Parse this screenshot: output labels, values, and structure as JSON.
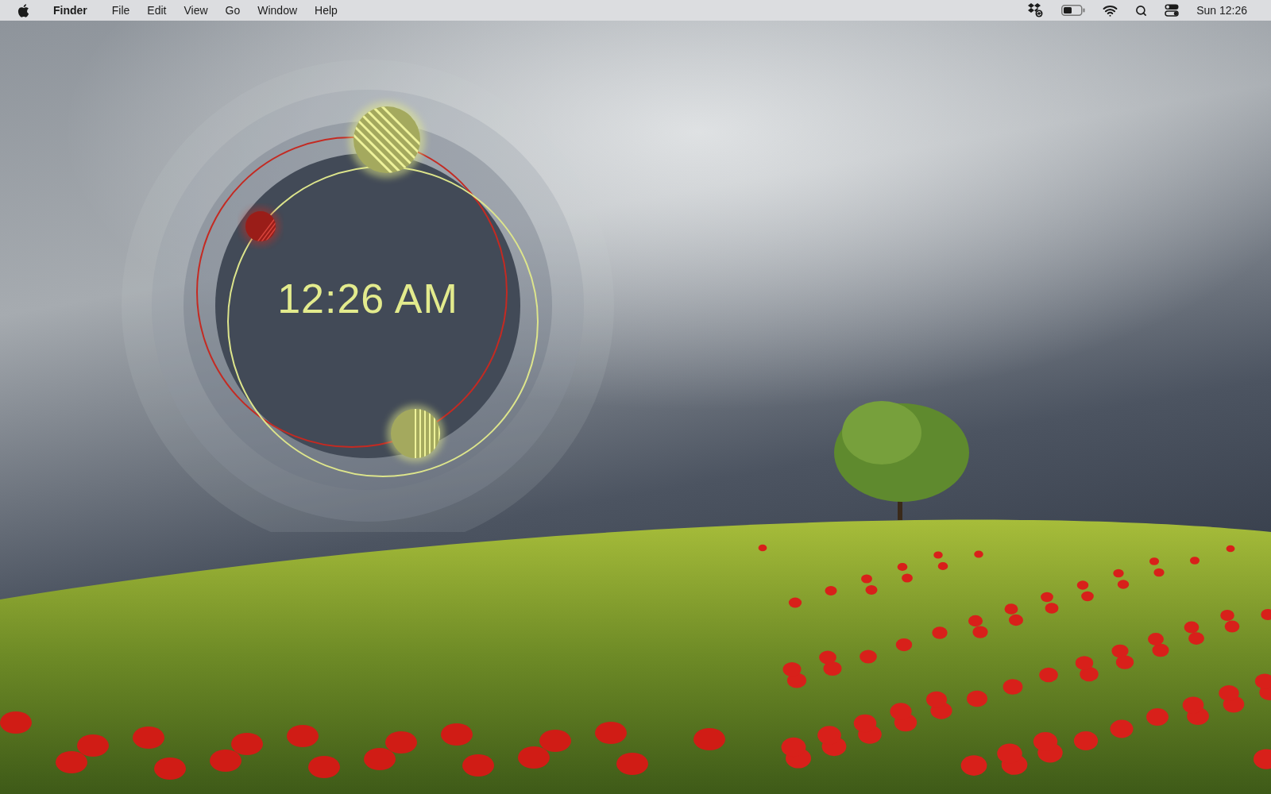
{
  "menu_bar": {
    "app_name": "Finder",
    "menus": [
      "File",
      "Edit",
      "View",
      "Go",
      "Window",
      "Help"
    ],
    "clock": "Sun 12:26"
  },
  "clock_widget": {
    "time": "12:26 AM"
  }
}
